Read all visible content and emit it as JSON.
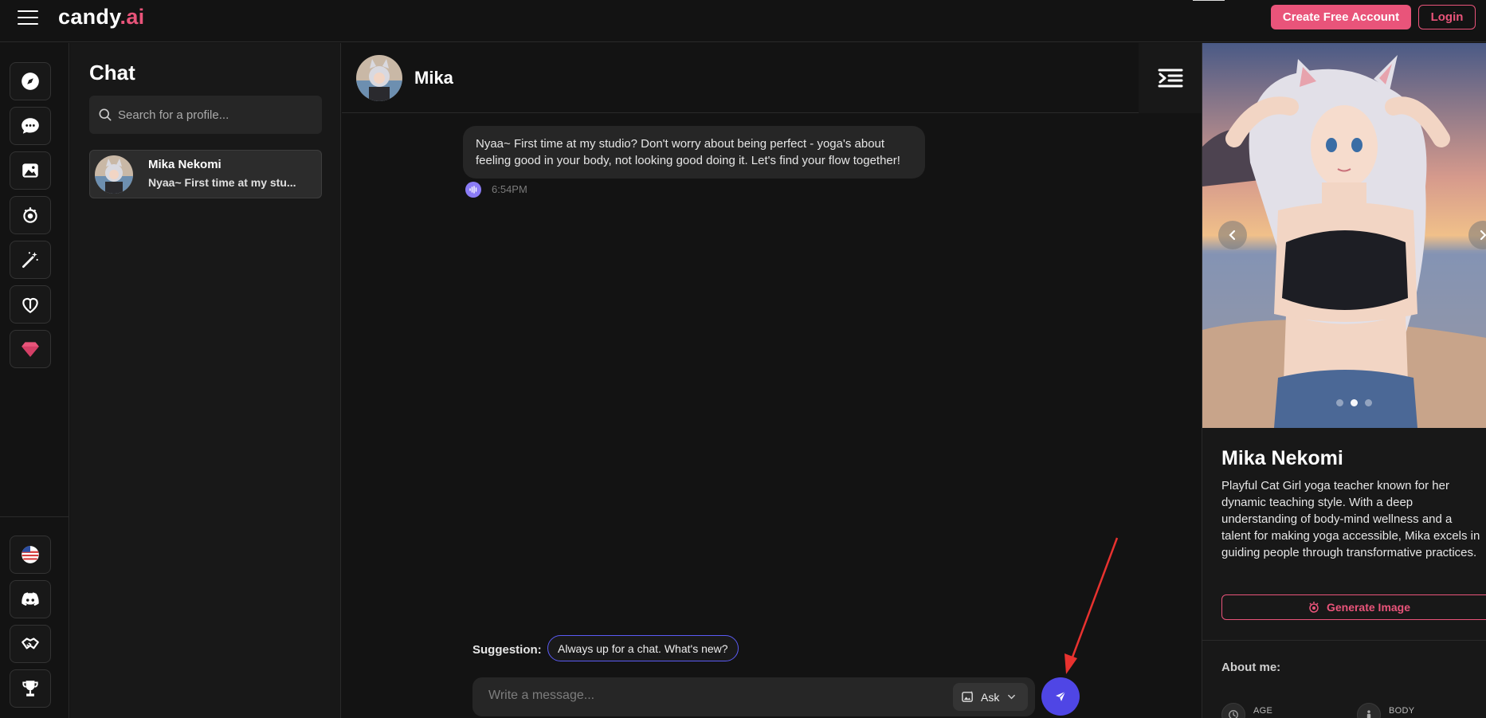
{
  "app": {
    "logo_main": "candy",
    "logo_accent": ".ai"
  },
  "header": {
    "create_account": "Create Free Account",
    "login": "Login"
  },
  "rail": {
    "items": [
      "explore-icon",
      "chat-icon",
      "gallery-icon",
      "generate-image-icon",
      "create-character-icon",
      "my-ai-icon",
      "premium-icon"
    ],
    "bottom_items": [
      "us-flag-icon",
      "discord-icon",
      "affiliate-icon",
      "trophy-icon"
    ]
  },
  "chatlist": {
    "title": "Chat",
    "search_placeholder": "Search for a profile...",
    "items": [
      {
        "name": "Mika Nekomi",
        "preview": "Nyaa~ First time at my stu..."
      }
    ]
  },
  "conversation": {
    "name": "Mika",
    "messages": [
      {
        "text": "Nyaa~ First time at my studio? Don't worry about being perfect - yoga's about feeling good in your body, not looking good doing it. Let's find your flow together!",
        "time": "6:54PM"
      }
    ],
    "suggestion_label": "Suggestion:",
    "suggestion": "Always up for a chat. What's new?",
    "input_placeholder": "Write a message...",
    "ask_label": "Ask"
  },
  "profile": {
    "name": "Mika Nekomi",
    "description": "Playful Cat Girl yoga teacher known for her dynamic teaching style. With a deep understanding of body-mind wellness and a talent for making yoga accessible, Mika excels in guiding people through transformative practices.",
    "generate_label": "Generate Image",
    "about_title": "About me:",
    "stats": [
      {
        "label": "AGE"
      },
      {
        "label": "BODY"
      }
    ],
    "carousel": {
      "total": 3,
      "active": 1
    }
  },
  "colors": {
    "accent": "#e9547a",
    "send": "#4f46e5",
    "voice": "#8b7cf6"
  }
}
